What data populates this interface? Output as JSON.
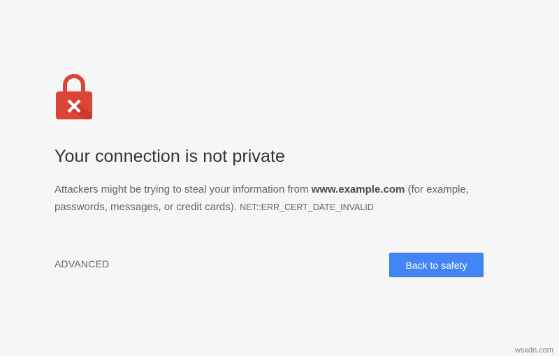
{
  "icon": {
    "name": "lock-error-icon",
    "lock_color": "#db4437",
    "shadow_color": "#b0352c",
    "mark_color": "#ffffff"
  },
  "interstitial": {
    "title": "Your connection is not private",
    "message_prefix": "Attackers might be trying to steal your information from ",
    "domain": "www.example.com",
    "message_suffix": " (for example, passwords, messages, or credit cards). ",
    "error_code": "NET::ERR_CERT_DATE_INVALID"
  },
  "actions": {
    "advanced_label": "ADVANCED",
    "primary_label": "Back to safety",
    "primary_color": "#4285f4"
  },
  "watermark": "wsxdn.com"
}
